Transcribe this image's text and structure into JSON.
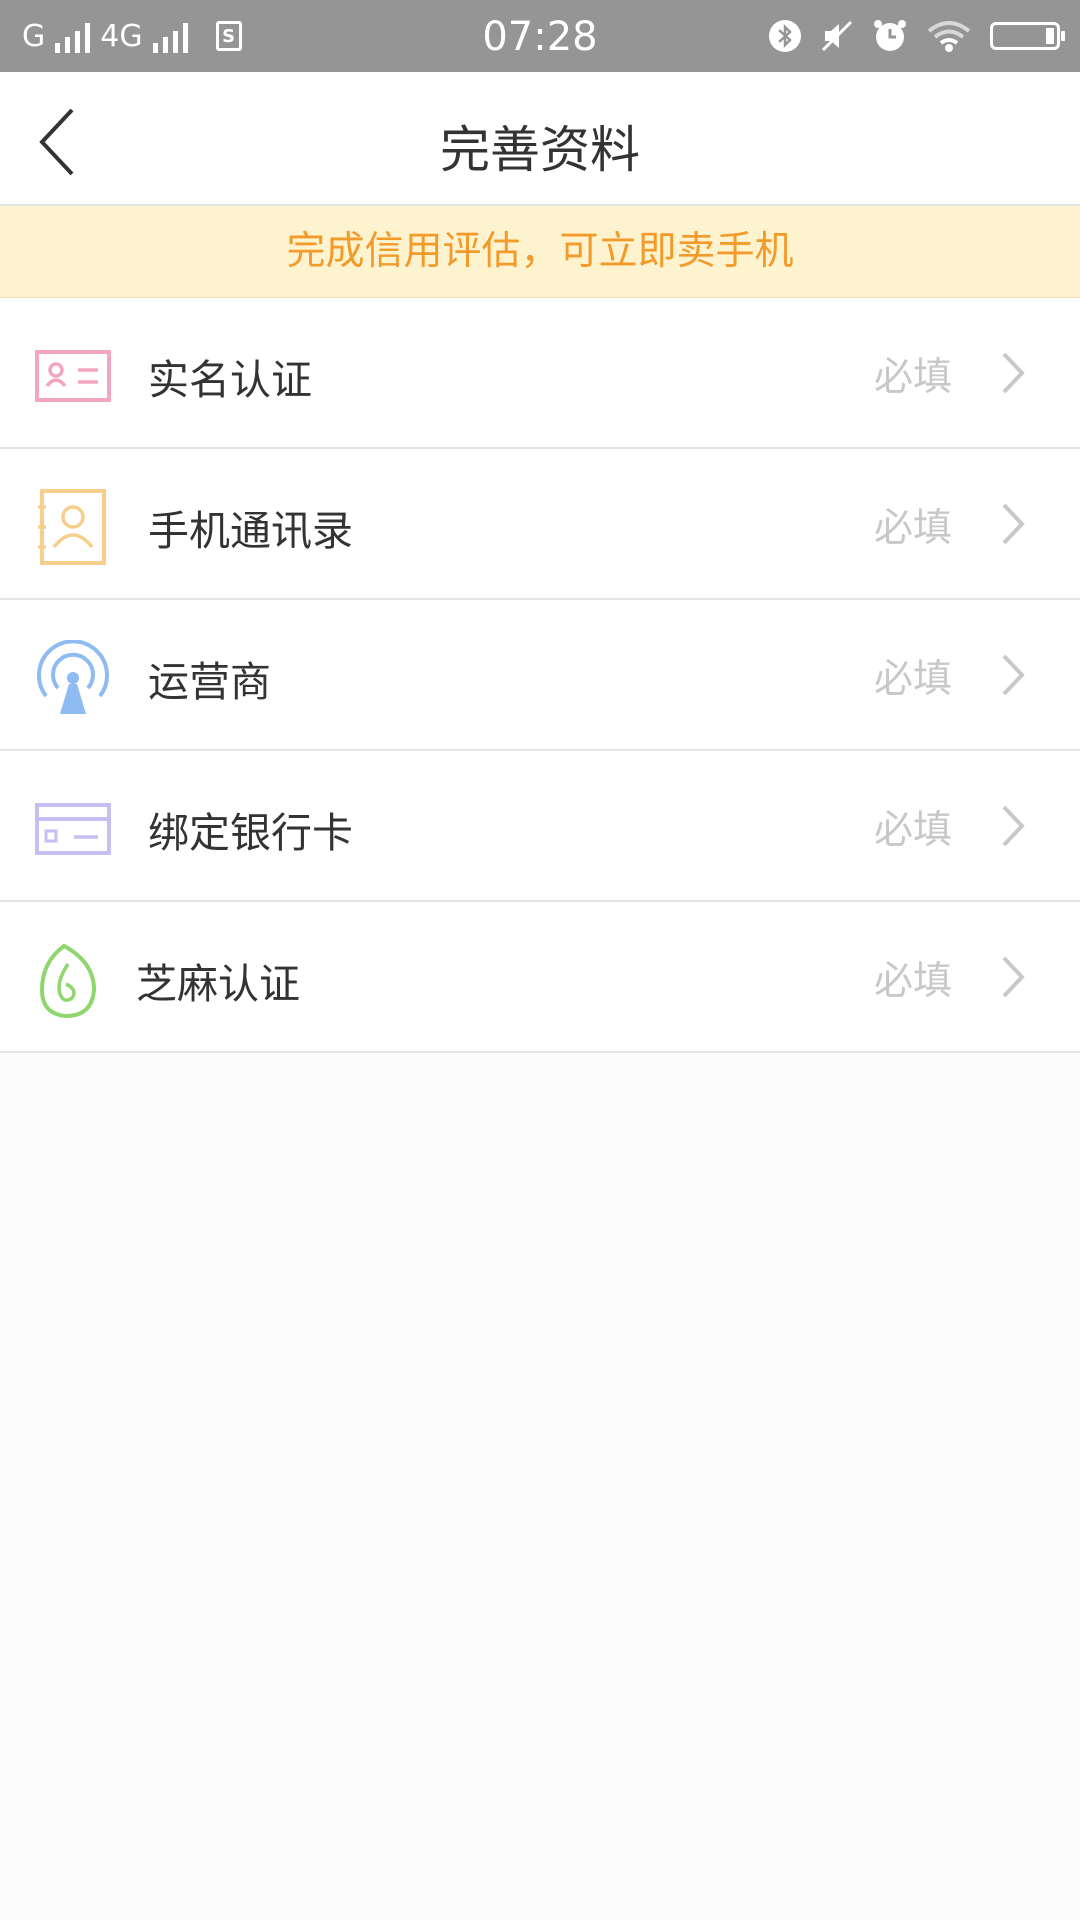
{
  "status_bar": {
    "carrier1": "G",
    "carrier2": "4G",
    "sim_label": "S",
    "time": "07:28"
  },
  "header": {
    "title": "完善资料"
  },
  "notice": {
    "text": "完成信用评估，可立即卖手机"
  },
  "items": [
    {
      "label": "实名认证",
      "status": "必填",
      "icon": "id-card-icon",
      "color": "#f4a6c0"
    },
    {
      "label": "手机通讯录",
      "status": "必填",
      "icon": "contacts-book-icon",
      "color": "#f7cf8c"
    },
    {
      "label": "运营商",
      "status": "必填",
      "icon": "signal-tower-icon",
      "color": "#8dbbf2"
    },
    {
      "label": "绑定银行卡",
      "status": "必填",
      "icon": "bank-card-icon",
      "color": "#c7bff2"
    },
    {
      "label": "芝麻认证",
      "status": "必填",
      "icon": "sesame-icon",
      "color": "#8fd66e"
    }
  ],
  "colors": {
    "notice_text": "#f29b2b",
    "notice_bg": "#fef3cf",
    "status_bar": "#959595"
  }
}
